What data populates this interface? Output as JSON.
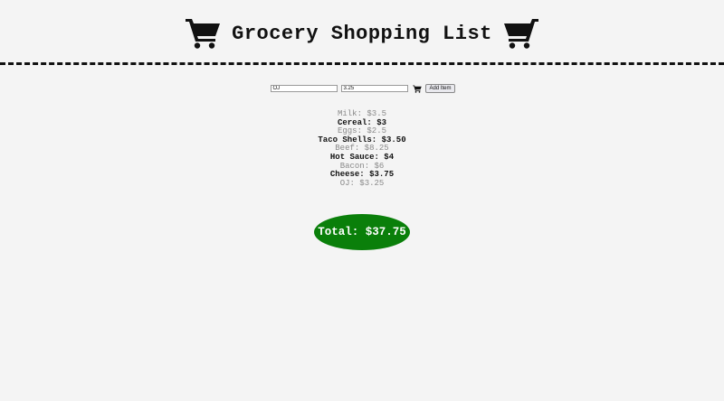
{
  "header": {
    "title": "Grocery Shopping List",
    "left_icon": "shopping-cart-icon",
    "right_icon": "shopping-cart-icon"
  },
  "form": {
    "name_value": "OJ",
    "price_value": "3.25",
    "cart_icon": "shopping-cart-icon",
    "add_label": "Add Item"
  },
  "items": [
    {
      "text": "Milk: $3.5",
      "style": "gray"
    },
    {
      "text": "Cereal: $3",
      "style": "dark"
    },
    {
      "text": "Eggs: $2.5",
      "style": "gray"
    },
    {
      "text": "Taco Shells: $3.50",
      "style": "dark"
    },
    {
      "text": "Beef: $8.25",
      "style": "gray"
    },
    {
      "text": "Hot Sauce: $4",
      "style": "dark"
    },
    {
      "text": "Bacon: $6",
      "style": "gray"
    },
    {
      "text": "Cheese: $3.75",
      "style": "dark"
    },
    {
      "text": "OJ: $3.25",
      "style": "gray"
    }
  ],
  "total": {
    "label": "Total: $37.75"
  },
  "colors": {
    "background": "#f4f4f4",
    "total_badge": "#0a7f0a",
    "gray_text": "#8a8a8a",
    "dark_text": "#111111"
  }
}
